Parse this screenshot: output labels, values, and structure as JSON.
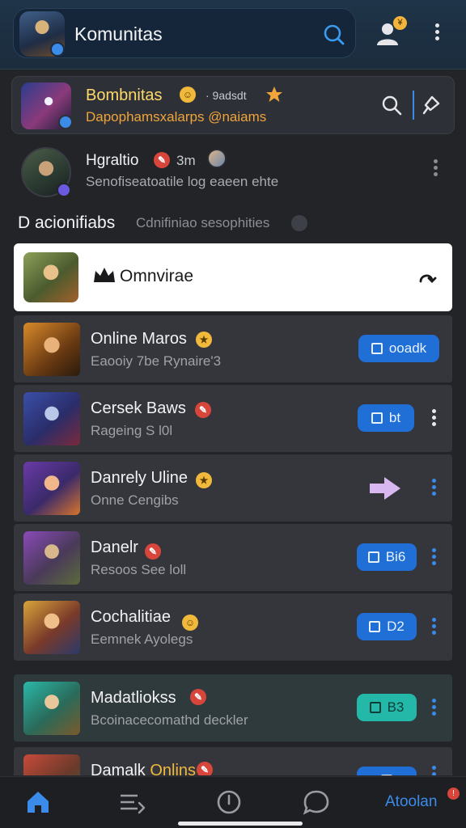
{
  "header": {
    "title": "Komunitas",
    "notification_badge": "¥"
  },
  "featured": {
    "title": "Bombnitas",
    "meta": "· 9adsdt",
    "subtitle": "Dapophamsxalarps @naiams"
  },
  "member": {
    "name": "Hgraltio",
    "extra": "3m",
    "subtitle": "Senofiseatoatile log eaeen ehte"
  },
  "section": {
    "title": "D acionifiabs",
    "subtitle": "Cdnifiniao sesophities"
  },
  "selected_row": {
    "label": "Omnvirae"
  },
  "communities": [
    {
      "title": "Online Maros",
      "subtitle": "Eaooiy 7be Rynaire'3",
      "badge": "gold",
      "action": "ooadk",
      "action_style": "blue",
      "more": false
    },
    {
      "title": "Cersek Baws",
      "subtitle": "Rageing S l0l",
      "badge": "red",
      "action": "bt",
      "action_style": "blue",
      "more": true
    },
    {
      "title": "Danrely Uline",
      "subtitle": "Onne Cengibs",
      "badge": "gold",
      "action": "",
      "action_style": "arrow",
      "more": true
    },
    {
      "title": "Danelr",
      "subtitle": "Resoos See loll",
      "badge": "red",
      "action": "Bi6",
      "action_style": "blue",
      "more": true
    },
    {
      "title": "Cochalitiae",
      "subtitle": "Eemnek Ayolegs",
      "badge": "gold",
      "action": "D2",
      "action_style": "blue",
      "more": true
    },
    {
      "title": "Madatliokss",
      "subtitle": "Bcoinacecomathd deckler",
      "badge": "red",
      "action": "B3",
      "action_style": "teal",
      "more": true
    },
    {
      "title": "Damalk",
      "title_accent": "Onlins",
      "subtitle": "",
      "badge": "red",
      "action": "",
      "action_style": "blue",
      "more": true
    }
  ],
  "bottom_nav": {
    "active_label": "Atoolan",
    "badge": "!"
  },
  "colors": {
    "accent": "#3a8bea",
    "gold": "#f1b93c",
    "orange": "#f0a43a",
    "teal": "#23b8a8",
    "danger": "#d8453b"
  },
  "icons": [
    "search-icon",
    "profile-icon",
    "more-vertical-icon",
    "pin-icon",
    "crown-icon",
    "arrow-right-icon",
    "home-icon",
    "list-icon",
    "clock-icon",
    "chat-icon"
  ]
}
